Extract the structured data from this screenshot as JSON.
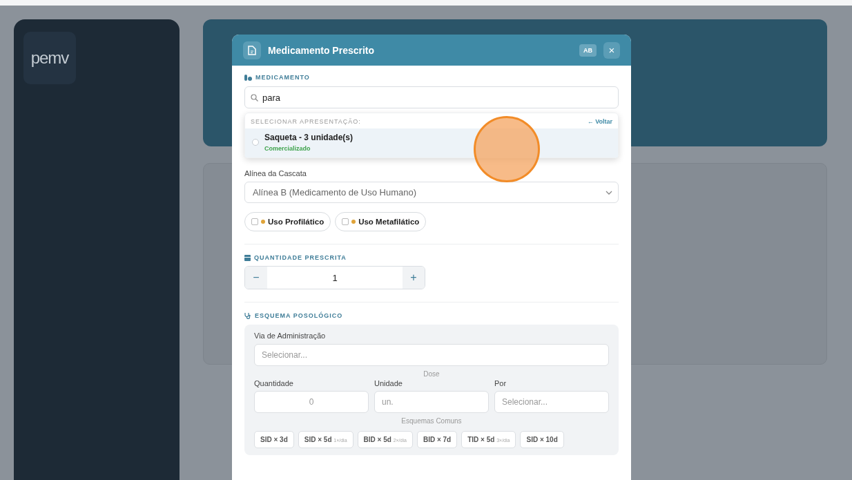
{
  "app": {
    "logo": "pemv"
  },
  "modal": {
    "title": "Medicamento Prescrito",
    "badge": "AB",
    "close": "×",
    "medication": {
      "label": "MEDICAMENTO",
      "search_value": "para",
      "dropdown": {
        "heading": "SELECIONAR APRESENTAÇÃO:",
        "back": "← Voltar",
        "options": [
          {
            "name": "Saqueta - 3 unidade(s)",
            "status": "Comercializado",
            "selected": false,
            "hovered": true
          }
        ]
      }
    },
    "cascade": {
      "label": "Alínea da Cascata",
      "value": "Alínea B (Medicamento de Uso Humano)"
    },
    "usage_options": [
      {
        "label": "Uso Profilático",
        "checked": false,
        "color": "#e0a43a"
      },
      {
        "label": "Uso Metafilático",
        "checked": false,
        "color": "#e0a43a"
      }
    ],
    "quantity": {
      "label": "QUANTIDADE PRESCRITA",
      "minus": "−",
      "value": "1",
      "plus": "+"
    },
    "dosage": {
      "label": "ESQUEMA POSOLÓGICO",
      "route_label": "Via de Administração",
      "route_placeholder": "Selecionar...",
      "dose_label": "Dose",
      "dose_fields": [
        {
          "label": "Quantidade",
          "placeholder": "0"
        },
        {
          "label": "Unidade",
          "placeholder": "un."
        },
        {
          "label": "Por",
          "placeholder": "Selecionar..."
        }
      ],
      "presets_label": "Esquemas Comuns",
      "presets": [
        {
          "label": "SID × 3d"
        },
        {
          "label": "SID × 5d",
          "note": "1×/dia"
        },
        {
          "label": "BID × 5d",
          "note": "2×/dia"
        },
        {
          "label": "BID × 7d"
        },
        {
          "label": "TID × 5d",
          "note": "3×/dia"
        },
        {
          "label": "SID × 10d"
        }
      ]
    }
  }
}
